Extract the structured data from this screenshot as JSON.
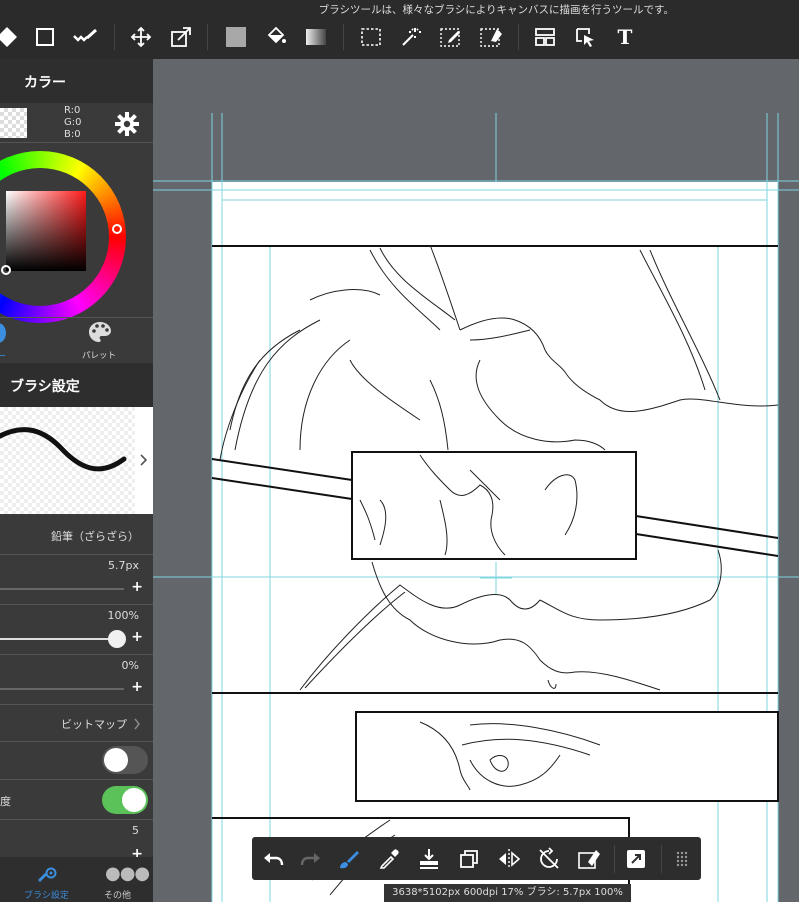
{
  "status_message": "ブラシツールは、様々なブラシによりキャンバスに描画を行うツールです。",
  "toolbar": {
    "tools": [
      "eraser-diamond-icon",
      "rect-shape-icon",
      "brush-stroke-icon",
      "move-icon",
      "transform-icon",
      "fill-color-icon",
      "bucket-icon",
      "gradient-icon",
      "select-rect-icon",
      "magic-wand-icon",
      "select-pen-icon",
      "select-eraser-icon",
      "frame-icon",
      "operation-icon",
      "text-icon"
    ],
    "text_tool_label": "T"
  },
  "color_panel": {
    "title": "カラー",
    "r": "R:0",
    "g": "G:0",
    "b": "B:0",
    "palette_label": "パレット"
  },
  "brush_panel": {
    "title": "ブラシ設定",
    "brush_name": "鉛筆（ざらざら）",
    "size": "5.7px",
    "opacity": "100%",
    "blur": "0%",
    "bitmap_label": "ビットマップ",
    "pressure_label": "度",
    "count_value": "5",
    "opacity_level": 1.0,
    "blur_level": 0.0,
    "size_level": 0.05
  },
  "bottom_tabs": {
    "brush_settings": "ブラシ設定",
    "other": "その他"
  },
  "info_bar": "3638*5102px 600dpi 17% ブラシ: 5.7px 100%",
  "colors": {
    "accent": "#3c8fe0",
    "toggle_on": "#5bc25a",
    "toolbar_bg": "#2b2b2b",
    "canvas_bg": "#63666b"
  }
}
